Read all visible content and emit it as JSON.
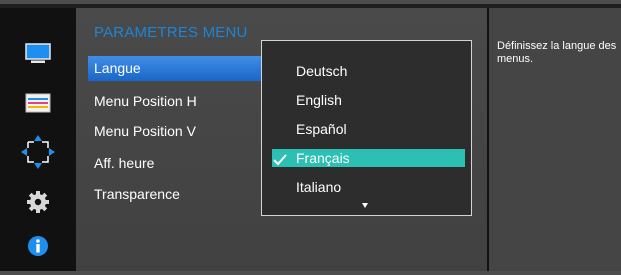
{
  "sidebar": {
    "icons": [
      "monitor-icon",
      "picture-settings-icon",
      "position-arrows-icon",
      "gear-icon",
      "info-icon"
    ]
  },
  "menu": {
    "title": "PARAMETRES MENU",
    "items": [
      {
        "label": "Langue"
      },
      {
        "label": "Menu Position H"
      },
      {
        "label": "Menu Position V"
      },
      {
        "label": "Aff. heure"
      },
      {
        "label": "Transparence"
      }
    ],
    "selected_index": 0
  },
  "dropdown": {
    "options": [
      {
        "label": "Deutsch"
      },
      {
        "label": "English"
      },
      {
        "label": "Español"
      },
      {
        "label": "Français"
      },
      {
        "label": "Italiano"
      }
    ],
    "selected_index": 3,
    "more_indicator": "chevron-down-icon"
  },
  "help": {
    "text": "Définissez la langue des menus."
  },
  "colors": {
    "title": "#1c85d6",
    "menu_highlight": "#2a7ad9",
    "option_highlight": "#2cbfb3",
    "icon_blue": "#1e8ef0"
  }
}
